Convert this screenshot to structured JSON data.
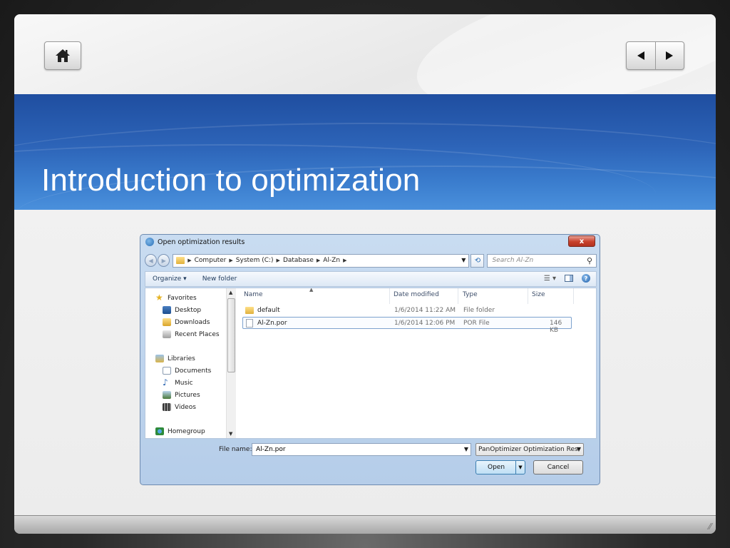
{
  "slide": {
    "title": "Introduction to optimization",
    "home_icon": "home-icon",
    "prev_icon": "triangle-left-icon",
    "next_icon": "triangle-right-icon"
  },
  "dialog": {
    "title": "Open optimization results",
    "close_label": "x",
    "breadcrumb": [
      "Computer",
      "System (C:)",
      "Database",
      "Al-Zn"
    ],
    "search_placeholder": "Search Al-Zn",
    "toolbar": {
      "organize": "Organize ▾",
      "new_folder": "New folder"
    },
    "nav": {
      "favorites": "Favorites",
      "desktop": "Desktop",
      "downloads": "Downloads",
      "recent_places": "Recent Places",
      "libraries": "Libraries",
      "documents": "Documents",
      "music": "Music",
      "pictures": "Pictures",
      "videos": "Videos",
      "homegroup": "Homegroup"
    },
    "columns": {
      "name": "Name",
      "date": "Date modified",
      "type": "Type",
      "size": "Size"
    },
    "files": [
      {
        "name": "default",
        "date": "1/6/2014 11:22 AM",
        "type": "File folder",
        "size": ""
      },
      {
        "name": "Al-Zn.por",
        "date": "1/6/2014 12:06 PM",
        "type": "POR File",
        "size": "146 KB"
      }
    ],
    "filename_label": "File name:",
    "filename_value": "Al-Zn.por",
    "filetype": "PanOptimizer Optimization Res",
    "open_label": "Open",
    "cancel_label": "Cancel"
  }
}
